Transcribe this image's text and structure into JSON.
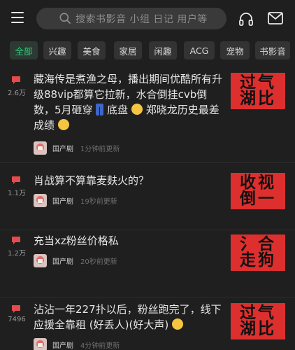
{
  "search": {
    "placeholder": "搜索书影音 小组 日记 用户等"
  },
  "tabs": [
    {
      "label": "全部",
      "active": true
    },
    {
      "label": "兴趣"
    },
    {
      "label": "美食"
    },
    {
      "label": "家居"
    },
    {
      "label": "闲趣"
    },
    {
      "label": "ACG"
    },
    {
      "label": "宠物"
    },
    {
      "label": "书影音"
    }
  ],
  "feed": [
    {
      "count": "2.6万",
      "title_parts": [
        "藏海传是煮渔之母，播出期间优酷所有升级88vip都算它拉新，水合倒挂cvb倒数，5月砸穿",
        "底盘",
        "郑晓龙历史最差成绩",
        ""
      ],
      "group": "国产剧",
      "time": "1分钟前更新",
      "thumb": [
        "过气",
        "湖比"
      ]
    },
    {
      "count": "1.1万",
      "title_parts": [
        "肖战算不算靠麦麸火的？"
      ],
      "group": "国产剧",
      "time": "19秒前更新",
      "thumb": [
        "收视",
        "倒一"
      ]
    },
    {
      "count": "1.2万",
      "title_parts": [
        "充当xz粉丝价格私"
      ],
      "group": "国产剧",
      "time": "20秒前更新",
      "thumb": [
        "氵合",
        "走狗"
      ]
    },
    {
      "count": "7496",
      "title_parts": [
        "沾沾一年227扑以后，粉丝跑完了，线下应援全靠租 (好丢人)(好大声)",
        ""
      ],
      "group": "国产剧",
      "time": "4分钟前更新",
      "thumb": [
        "过气",
        "湖比"
      ]
    }
  ],
  "colors": {
    "accent": "#34c77b",
    "comment": "#e64b4b",
    "thumb_bg": "#de2f2f"
  },
  "icons": [
    "menu-icon",
    "search-icon",
    "headphones-icon",
    "mail-icon",
    "comment-icon"
  ]
}
